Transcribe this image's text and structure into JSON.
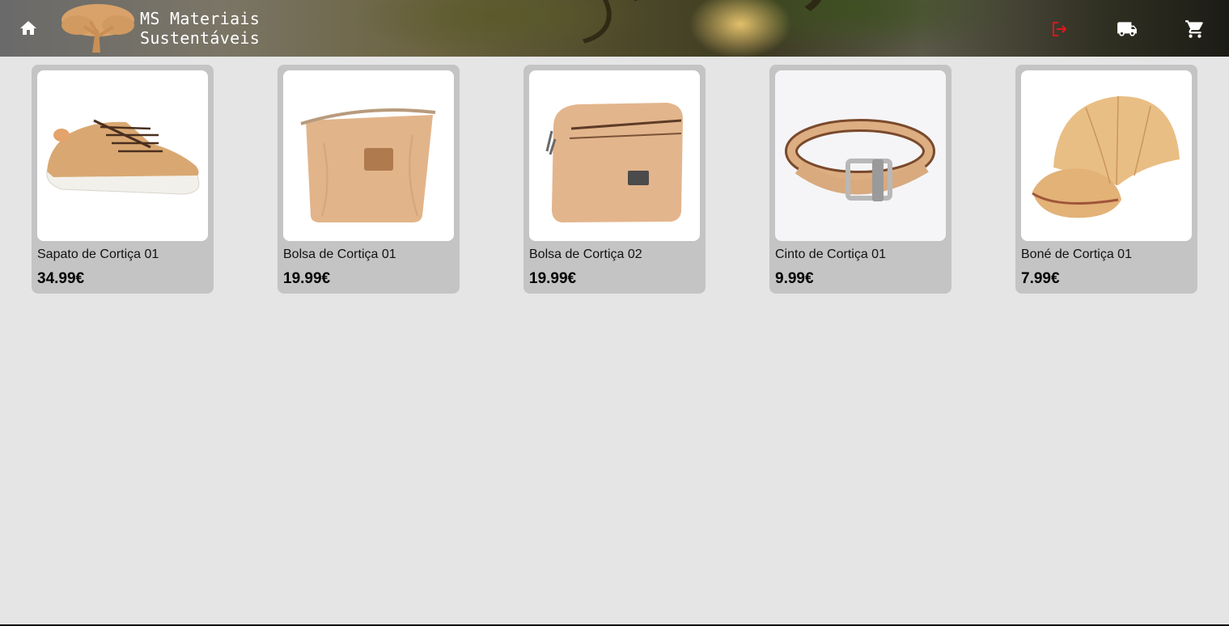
{
  "header": {
    "brand_line1": "MS Materiais",
    "brand_line2": "Sustentáveis",
    "icons": {
      "home": "home-icon",
      "logout": "logout-icon",
      "shipping": "truck-icon",
      "cart": "cart-icon"
    },
    "logout_color": "#e8141b"
  },
  "products": [
    {
      "name": "Sapato de Cortiça 01",
      "price": "34.99€",
      "image": "cork-sneaker-image"
    },
    {
      "name": "Bolsa de Cortiça 01",
      "price": "19.99€",
      "image": "cork-pouch-image"
    },
    {
      "name": "Bolsa de Cortiça 02",
      "price": "19.99€",
      "image": "cork-bag-image"
    },
    {
      "name": "Cinto de Cortiça 01",
      "price": "9.99€",
      "image": "cork-belt-image"
    },
    {
      "name": "Boné de Cortiça 01",
      "price": "7.99€",
      "image": "cork-cap-image"
    }
  ],
  "colors": {
    "background": "#e5e5e5",
    "card": "#c4c4c4",
    "cork": "#d9a872"
  }
}
